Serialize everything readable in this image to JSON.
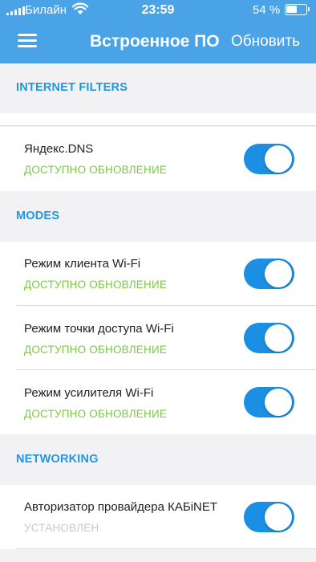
{
  "status_bar": {
    "carrier": "Билайн",
    "time": "23:59",
    "battery_percent": "54 %",
    "battery_level": 0.54
  },
  "header": {
    "title": "Встроенное ПО",
    "refresh_label": "Обновить",
    "menu_icon": "hamburger-menu-icon"
  },
  "sections": [
    {
      "title": "INTERNET FILTERS",
      "items": [
        {
          "label": "Яндекс.DNS",
          "status": "ДОСТУПНО ОБНОВЛЕНИЕ",
          "enabled": true
        }
      ]
    },
    {
      "title": "MODES",
      "items": [
        {
          "label": "Режим клиента Wi-Fi",
          "status": "ДОСТУПНО ОБНОВЛЕНИЕ",
          "enabled": true
        },
        {
          "label": "Режим точки доступа Wi-Fi",
          "status": "ДОСТУПНО ОБНОВЛЕНИЕ",
          "enabled": true
        },
        {
          "label": "Режим усилителя Wi-Fi",
          "status": "ДОСТУПНО ОБНОВЛЕНИЕ",
          "enabled": true
        }
      ]
    },
    {
      "title": "NETWORKING",
      "items": [
        {
          "label": "Авторизатор провайдера КАБiNET",
          "status": "УСТАНОВЛЕН",
          "enabled": true
        }
      ]
    }
  ],
  "colors": {
    "header_bg": "#4aa3e6",
    "section_title": "#2196e6",
    "status_available": "#7ac943",
    "status_installed": "#c9c9cc",
    "toggle_on": "#1a8fe3"
  }
}
